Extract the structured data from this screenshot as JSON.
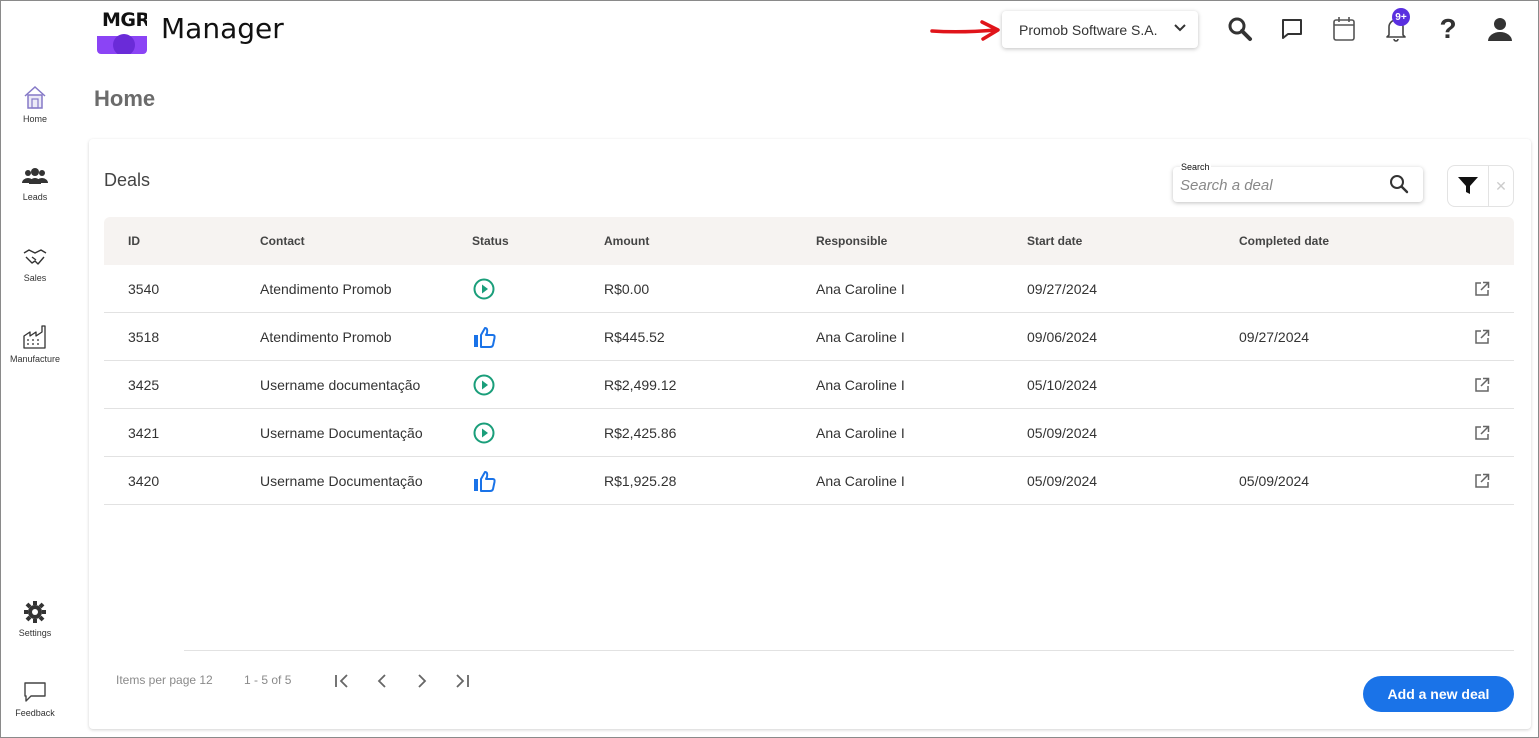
{
  "app": {
    "logo_text": "MGR",
    "title": "Manager"
  },
  "header": {
    "company": "Promob Software S.A.",
    "notification_badge": "9+",
    "icons": [
      "search-icon",
      "chat-icon",
      "calendar-icon",
      "bell-icon",
      "help-icon",
      "user-icon"
    ],
    "annotation_color": "#e0141a"
  },
  "sidebar": {
    "items": [
      {
        "label": "Home",
        "icon": "home-icon"
      },
      {
        "label": "Leads",
        "icon": "people-icon"
      },
      {
        "label": "Sales",
        "icon": "handshake-icon"
      },
      {
        "label": "Manufacture",
        "icon": "factory-icon"
      }
    ],
    "bottom": [
      {
        "label": "Settings",
        "icon": "gear-icon"
      },
      {
        "label": "Feedback",
        "icon": "feedback-icon"
      }
    ]
  },
  "page": {
    "title": "Home"
  },
  "deals": {
    "title": "Deals",
    "search_label": "Search",
    "search_placeholder": "Search a deal",
    "columns": [
      "ID",
      "Contact",
      "Status",
      "Amount",
      "Responsible",
      "Start date",
      "Completed date"
    ],
    "rows": [
      {
        "id": "3540",
        "contact": "Atendimento Promob",
        "status": "in-progress",
        "amount": "R$0.00",
        "responsible": "Ana Caroline I",
        "start": "09/27/2024",
        "completed": ""
      },
      {
        "id": "3518",
        "contact": "Atendimento Promob",
        "status": "won",
        "amount": "R$445.52",
        "responsible": "Ana Caroline I",
        "start": "09/06/2024",
        "completed": "09/27/2024"
      },
      {
        "id": "3425",
        "contact": "Username documentação",
        "status": "in-progress",
        "amount": "R$2,499.12",
        "responsible": "Ana Caroline I",
        "start": "05/10/2024",
        "completed": ""
      },
      {
        "id": "3421",
        "contact": "Username Documentação",
        "status": "in-progress",
        "amount": "R$2,425.86",
        "responsible": "Ana Caroline I",
        "start": "05/09/2024",
        "completed": ""
      },
      {
        "id": "3420",
        "contact": "Username Documentação",
        "status": "won",
        "amount": "R$1,925.28",
        "responsible": "Ana Caroline I",
        "start": "05/09/2024",
        "completed": "05/09/2024"
      }
    ],
    "status_colors": {
      "in-progress": "#1a9e7a",
      "won": "#1a73e8"
    }
  },
  "pagination": {
    "items_per_page": "Items per page 12",
    "range": "1 - 5 of 5"
  },
  "actions": {
    "add_label": "Add a new deal",
    "accent": "#1a73e8"
  }
}
